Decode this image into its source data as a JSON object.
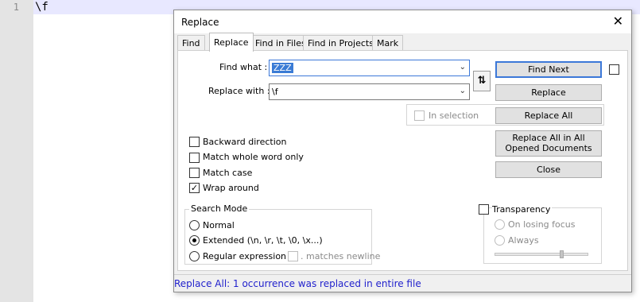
{
  "editor": {
    "line_number": "1",
    "text": "\\f"
  },
  "dialog": {
    "title": "Replace",
    "close_glyph": "✕"
  },
  "tabs": [
    "Find",
    "Replace",
    "Find in Files",
    "Find in Projects",
    "Mark"
  ],
  "find_what": {
    "label": "Find what :",
    "value": "ZZZ"
  },
  "replace_with": {
    "label": "Replace with :",
    "value": "\\f"
  },
  "swap_glyph": "⇅",
  "in_selection": "In selection",
  "buttons": {
    "find_next": "Find Next",
    "replace": "Replace",
    "replace_all": "Replace All",
    "replace_all_opened": "Replace All in All Opened Documents",
    "close": "Close"
  },
  "options": {
    "backward": "Backward direction",
    "whole_word": "Match whole word only",
    "match_case": "Match case",
    "wrap_around": "Wrap around",
    "wrap_checked": true
  },
  "search_mode": {
    "title": "Search Mode",
    "normal": "Normal",
    "extended": "Extended (\\n, \\r, \\t, \\0, \\x...)",
    "regex": "Regular expression",
    "matches_newline": ". matches newline",
    "selected": "extended"
  },
  "transparency": {
    "title": "Transparency",
    "on_losing_focus": "On losing focus",
    "always": "Always"
  },
  "status": "Replace All: 1 occurrence was replaced in entire file"
}
